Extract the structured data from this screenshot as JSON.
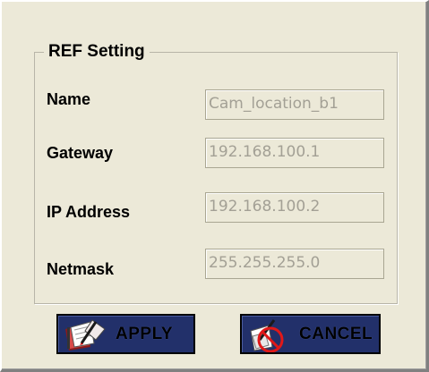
{
  "group": {
    "title": "REF Setting"
  },
  "fields": [
    {
      "label": "Name",
      "value": "Cam_location_b1"
    },
    {
      "label": "Gateway",
      "value": "192.168.100.1"
    },
    {
      "label": "IP Address",
      "value": "192.168.100.2"
    },
    {
      "label": "Netmask",
      "value": "255.255.255.0"
    }
  ],
  "buttons": {
    "apply_label": "APPLY",
    "cancel_label": "CANCEL",
    "apply_icon": "notebook-pen-icon",
    "cancel_icon": "no-edit-icon"
  },
  "colors": {
    "dialog_bg": "#ece9d8",
    "button_bg": "#22306a",
    "disabled_text": "#a3a095"
  }
}
